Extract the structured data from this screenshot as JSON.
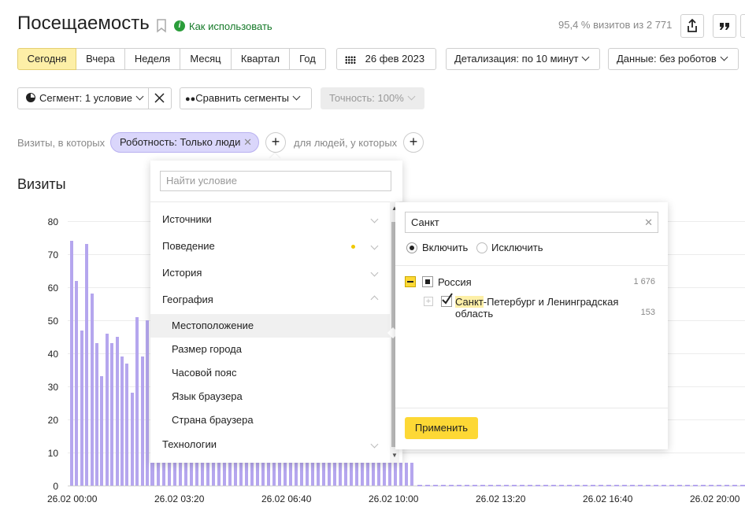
{
  "header": {
    "title": "Посещаемость",
    "help_link": "Как использовать",
    "visits_info": "95,4 % визитов из 2 771"
  },
  "periods": [
    "Сегодня",
    "Вчера",
    "Неделя",
    "Месяц",
    "Квартал",
    "Год"
  ],
  "date_button": "26 фев 2023",
  "detail_select": "Детализация: по 10 минут",
  "data_select": "Данные: без роботов",
  "segment_button": "Сегмент: 1 условие",
  "compare_button": "Сравнить сегменты",
  "accuracy_button": "Точность: 100%",
  "filter": {
    "prefix": "Визиты, в которых",
    "chip": "Роботность: Только люди",
    "middle": "для людей, у которых"
  },
  "chart_title": "Визиты",
  "chart_data": {
    "type": "bar",
    "ylim": [
      0,
      80
    ],
    "yticks": [
      "0",
      "10",
      "20",
      "30",
      "40",
      "50",
      "60",
      "70",
      "80"
    ],
    "xticks": [
      "26.02 00:00",
      "26.02 03:20",
      "26.02 06:40",
      "26.02 10:00",
      "26.02 13:20",
      "26.02 16:40",
      "26.02 20:00"
    ],
    "values": [
      74,
      62,
      47,
      73,
      58,
      43,
      33,
      46,
      43,
      45,
      39,
      37,
      28,
      51,
      39,
      50,
      37
    ]
  },
  "condition_menu": {
    "search_placeholder": "Найти условие",
    "groups": [
      "Источники",
      "Поведение",
      "История",
      "География"
    ],
    "geo_items": [
      "Местоположение",
      "Размер города",
      "Часовой пояс",
      "Язык браузера",
      "Страна браузера"
    ],
    "last_group": "Технологии"
  },
  "location_panel": {
    "search_value": "Санкт",
    "include_label": "Включить",
    "exclude_label": "Исключить",
    "tree": {
      "country": "Россия",
      "country_count": "1 676",
      "region_highlight": "Санкт",
      "region_rest": "-Петербург и Ленинградская",
      "region_rest2": "область",
      "region_count": "153"
    },
    "apply_label": "Применить"
  }
}
